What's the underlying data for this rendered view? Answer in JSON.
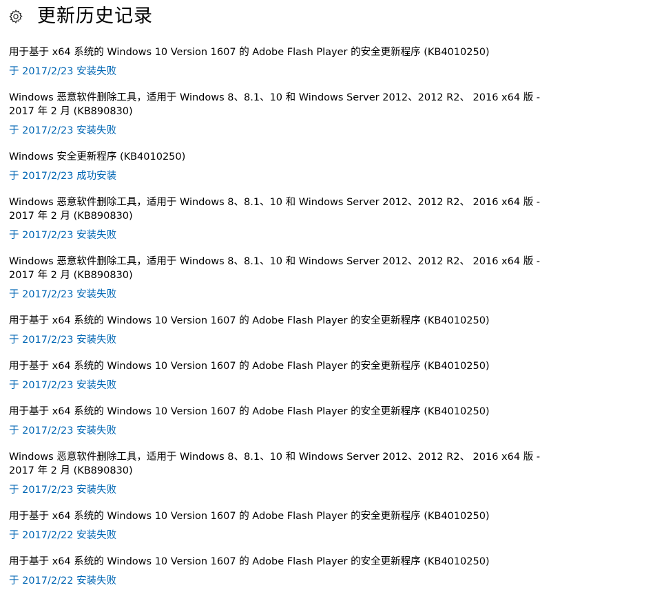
{
  "header": {
    "icon": "gear-icon",
    "title": "更新历史记录"
  },
  "colors": {
    "link": "#0066b4",
    "text": "#000000",
    "background": "#ffffff"
  },
  "updates": [
    {
      "name": "用于基于 x64 系统的 Windows 10 Version 1607 的 Adobe Flash Player 的安全更新程序 (KB4010250)",
      "status": "于 2017/2/23 安装失败"
    },
    {
      "name": "Windows 恶意软件删除工具，适用于 Windows 8、8.1、10 和 Windows Server 2012、2012 R2、 2016 x64 版 - 2017 年 2 月 (KB890830)",
      "status": "于 2017/2/23 安装失败"
    },
    {
      "name": "Windows 安全更新程序 (KB4010250)",
      "status": "于 2017/2/23 成功安装"
    },
    {
      "name": "Windows 恶意软件删除工具，适用于 Windows 8、8.1、10 和 Windows Server 2012、2012 R2、 2016 x64 版 - 2017 年 2 月 (KB890830)",
      "status": "于 2017/2/23 安装失败"
    },
    {
      "name": "Windows 恶意软件删除工具，适用于 Windows 8、8.1、10 和 Windows Server 2012、2012 R2、 2016 x64 版 - 2017 年 2 月 (KB890830)",
      "status": "于 2017/2/23 安装失败"
    },
    {
      "name": "用于基于 x64 系统的 Windows 10 Version 1607 的 Adobe Flash Player 的安全更新程序 (KB4010250)",
      "status": "于 2017/2/23 安装失败"
    },
    {
      "name": "用于基于 x64 系统的 Windows 10 Version 1607 的 Adobe Flash Player 的安全更新程序 (KB4010250)",
      "status": "于 2017/2/23 安装失败"
    },
    {
      "name": "用于基于 x64 系统的 Windows 10 Version 1607 的 Adobe Flash Player 的安全更新程序 (KB4010250)",
      "status": "于 2017/2/23 安装失败"
    },
    {
      "name": "Windows 恶意软件删除工具，适用于 Windows 8、8.1、10 和 Windows Server 2012、2012 R2、 2016 x64 版 - 2017 年 2 月 (KB890830)",
      "status": "于 2017/2/23 安装失败"
    },
    {
      "name": "用于基于 x64 系统的 Windows 10 Version 1607 的 Adobe Flash Player 的安全更新程序 (KB4010250)",
      "status": "于 2017/2/22 安装失败"
    },
    {
      "name": "用于基于 x64 系统的 Windows 10 Version 1607 的 Adobe Flash Player 的安全更新程序 (KB4010250)",
      "status": "于 2017/2/22 安装失败"
    }
  ]
}
